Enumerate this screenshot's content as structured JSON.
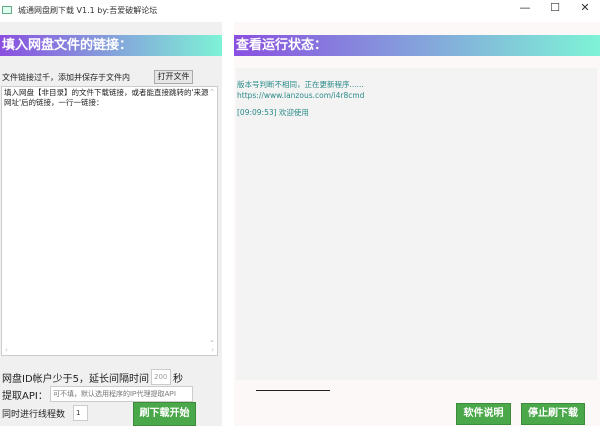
{
  "window": {
    "title": "城通网盘刷下载 V1.1 by:吾爱破解论坛",
    "minimize": "—",
    "maximize": "☐",
    "close": "✕"
  },
  "left": {
    "header": "填入网盘文件的链接：",
    "hint": "文件链接过千，添加并保存于文件内",
    "open_file": "打开文件",
    "links_text": "填入网盘【非目录】的文件下载链接，或者能直接跳转的'来源网址'后的链接，一行一链接：",
    "delay_label": "网盘ID帐户少于5，延长间隔时间",
    "delay_value": "200",
    "delay_unit": "秒",
    "api_label": "提取API：",
    "api_placeholder": "可不填，默认选用程序的IP代理提取API",
    "threads_label": "同时进行线程数",
    "threads_value": "1",
    "start": "刷下载开始"
  },
  "right": {
    "header": "查看运行状态：",
    "log": [
      "版本号判断不相同，正在更新程序......",
      "https://www.lanzous.com/i4r8cmd",
      "[09:09:53] 欢迎使用"
    ],
    "help": "软件说明",
    "stop": "停止刷下载"
  }
}
